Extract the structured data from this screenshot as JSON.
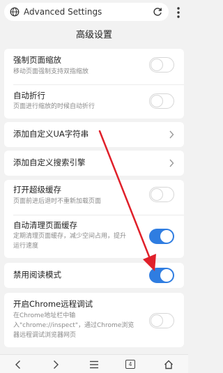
{
  "address_bar": {
    "url_text": "Advanced Settings"
  },
  "header": {
    "title": "高级设置"
  },
  "settings": {
    "force_zoom": {
      "title": "强制页面缩放",
      "subtitle": "移动页面强制支持双指缩放",
      "enabled": false
    },
    "auto_wrap": {
      "title": "自动折行",
      "subtitle": "页面进行缩放的时候自动折行",
      "enabled": false
    },
    "custom_ua": {
      "title": "添加自定义UA字符串"
    },
    "custom_search": {
      "title": "添加自定义搜索引擎"
    },
    "super_cache": {
      "title": "打开超级缓存",
      "subtitle": "页面前进后退时不重新加载页面",
      "enabled": false
    },
    "auto_clear_cache": {
      "title": "自动清理页面缓存",
      "subtitle_line1": "定期清理页面缓存，减少空间占用，提升",
      "subtitle_line2": "运行速度",
      "enabled": true
    },
    "disable_reader": {
      "title": "禁用阅读模式",
      "enabled": true
    },
    "chrome_debug": {
      "title": "开启Chrome远程调试",
      "subtitle_line1": "在Chrome地址栏中输",
      "subtitle_line2": "入\"chrome://inspect\"，通过Chrome浏览",
      "subtitle_line3": "器远程调试浏览器网页",
      "enabled": false
    }
  },
  "bottom_nav": {
    "tab_count": "4"
  },
  "colors": {
    "accent": "#2f7de1",
    "arrow": "#e0202a",
    "background": "#f2f2f2"
  },
  "icons": [
    "globe-icon",
    "reload-icon",
    "more-vert-icon",
    "chevron-right-icon",
    "back-icon",
    "forward-icon",
    "menu-icon",
    "tabs-icon",
    "home-icon"
  ]
}
